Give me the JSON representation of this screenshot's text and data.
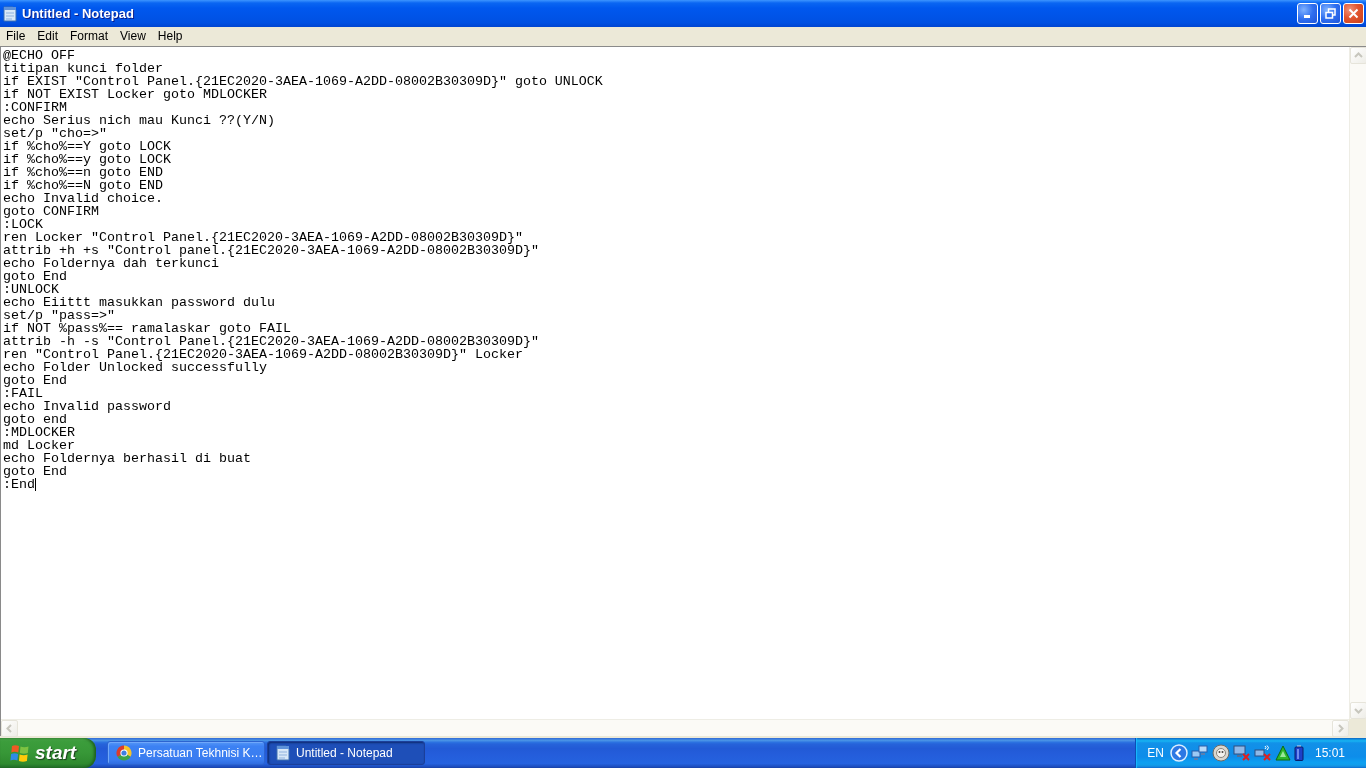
{
  "window": {
    "title": "Untitled - Notepad"
  },
  "menu": [
    "File",
    "Edit",
    "Format",
    "View",
    "Help"
  ],
  "editor": {
    "caret": true,
    "lines": [
      "@ECHO OFF",
      "titipan kunci folder",
      "if EXIST \"Control Panel.{21EC2020-3AEA-1069-A2DD-08002B30309D}\" goto UNLOCK",
      "if NOT EXIST Locker goto MDLOCKER",
      ":CONFIRM",
      "echo Serius nich mau Kunci ??(Y/N)",
      "set/p \"cho=>\"",
      "if %cho%==Y goto LOCK",
      "if %cho%==y goto LOCK",
      "if %cho%==n goto END",
      "if %cho%==N goto END",
      "echo Invalid choice.",
      "goto CONFIRM",
      ":LOCK",
      "ren Locker \"Control Panel.{21EC2020-3AEA-1069-A2DD-08002B30309D}\"",
      "attrib +h +s \"Control panel.{21EC2020-3AEA-1069-A2DD-08002B30309D}\"",
      "echo Foldernya dah terkunci",
      "goto End",
      ":UNLOCK",
      "echo Eiittt masukkan password dulu",
      "set/p \"pass=>\"",
      "if NOT %pass%== ramalaskar goto FAIL",
      "attrib -h -s \"Control Panel.{21EC2020-3AEA-1069-A2DD-08002B30309D}\"",
      "ren \"Control Panel.{21EC2020-3AEA-1069-A2DD-08002B30309D}\" Locker",
      "echo Folder Unlocked successfully",
      "goto End",
      ":FAIL",
      "echo Invalid password",
      "goto end",
      ":MDLOCKER",
      "md Locker",
      "echo Foldernya berhasil di buat",
      "goto End",
      ":End"
    ]
  },
  "taskbar": {
    "start_label": "start",
    "tasks": [
      {
        "kind": "browser",
        "label": "Persatuan Tekhnisi K…",
        "selected": false
      },
      {
        "kind": "notepad",
        "label": "Untitled - Notepad",
        "selected": true
      }
    ],
    "tray": {
      "language": "EN",
      "clock": "15:01"
    }
  }
}
